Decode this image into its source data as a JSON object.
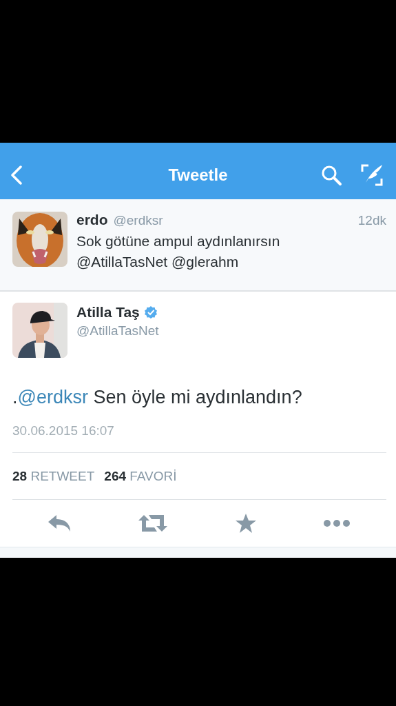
{
  "nav": {
    "title": "Tweetle"
  },
  "reply_tweet": {
    "name": "erdo",
    "handle": "@erdksr",
    "time": "12dk",
    "text": "Sok götüne ampul aydınlanırsın @AtillaTasNet @glerahm"
  },
  "tweet": {
    "name": "Atilla Taş",
    "verified": true,
    "handle": "@AtillaTasNet",
    "text_prefix": ".",
    "mention": "@erdksr",
    "text": "Sen öyle mi aydınlandın?",
    "timestamp": "30.06.2015 16:07"
  },
  "stats": [
    {
      "count": "28",
      "label": "RETWEET"
    },
    {
      "count": "264",
      "label": "FAVORİ"
    }
  ],
  "actions": [
    {
      "kind": "reply"
    },
    {
      "kind": "retweet"
    },
    {
      "kind": "favorite"
    },
    {
      "kind": "more"
    }
  ]
}
